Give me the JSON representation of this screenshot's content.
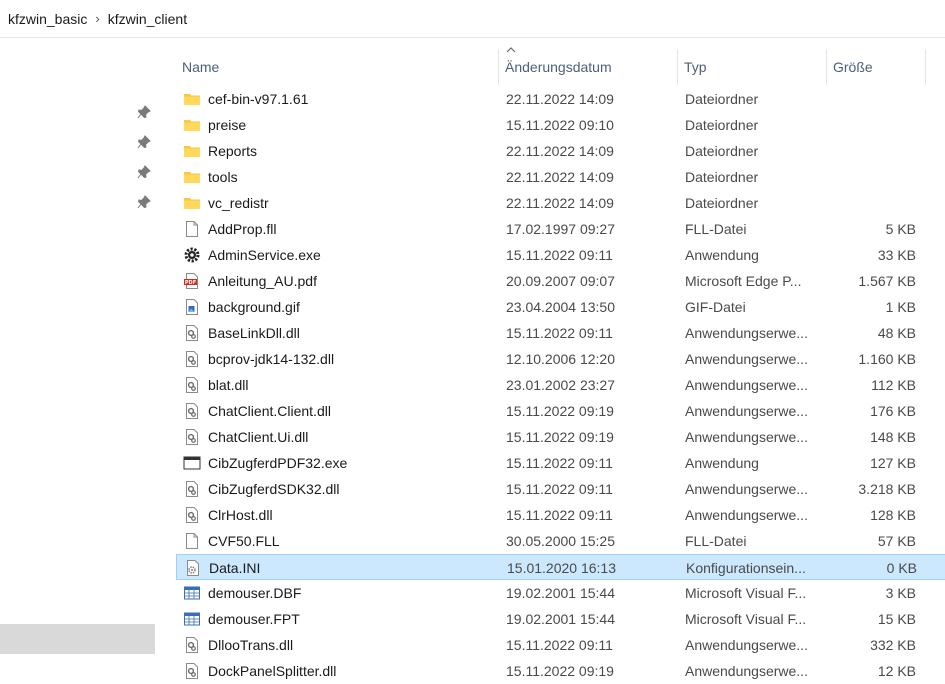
{
  "breadcrumb": [
    "kfzwin_basic",
    "kfzwin_client"
  ],
  "breadcrumb_separator": "›",
  "columns": {
    "name": "Name",
    "date": "Änderungsdatum",
    "type": "Typ",
    "size": "Größe"
  },
  "sort_indicator": "^",
  "files": [
    {
      "name": "cef-bin-v97.1.61",
      "date": "22.11.2022 14:09",
      "type": "Dateiordner",
      "size": "",
      "icon": "folder-icon"
    },
    {
      "name": "preise",
      "date": "15.11.2022 09:10",
      "type": "Dateiordner",
      "size": "",
      "icon": "folder-icon"
    },
    {
      "name": "Reports",
      "date": "22.11.2022 14:09",
      "type": "Dateiordner",
      "size": "",
      "icon": "folder-icon"
    },
    {
      "name": "tools",
      "date": "22.11.2022 14:09",
      "type": "Dateiordner",
      "size": "",
      "icon": "folder-icon"
    },
    {
      "name": "vc_redistr",
      "date": "22.11.2022 14:09",
      "type": "Dateiordner",
      "size": "",
      "icon": "folder-icon"
    },
    {
      "name": "AddProp.fll",
      "date": "17.02.1997 09:27",
      "type": "FLL-Datei",
      "size": "5 KB",
      "icon": "blank-file-icon"
    },
    {
      "name": "AdminService.exe",
      "date": "15.11.2022 09:11",
      "type": "Anwendung",
      "size": "33 KB",
      "icon": "gear-exe-icon"
    },
    {
      "name": "Anleitung_AU.pdf",
      "date": "20.09.2007 09:07",
      "type": "Microsoft Edge P...",
      "size": "1.567 KB",
      "icon": "pdf-icon"
    },
    {
      "name": "background.gif",
      "date": "23.04.2004 13:50",
      "type": "GIF-Datei",
      "size": "1 KB",
      "icon": "image-file-icon"
    },
    {
      "name": "BaseLinkDll.dll",
      "date": "15.11.2022 09:11",
      "type": "Anwendungserwe...",
      "size": "48 KB",
      "icon": "dll-icon"
    },
    {
      "name": "bcprov-jdk14-132.dll",
      "date": "12.10.2006 12:20",
      "type": "Anwendungserwe...",
      "size": "1.160 KB",
      "icon": "dll-icon"
    },
    {
      "name": "blat.dll",
      "date": "23.01.2002 23:27",
      "type": "Anwendungserwe...",
      "size": "112 KB",
      "icon": "dll-icon"
    },
    {
      "name": "ChatClient.Client.dll",
      "date": "15.11.2022 09:19",
      "type": "Anwendungserwe...",
      "size": "176 KB",
      "icon": "dll-icon"
    },
    {
      "name": "ChatClient.Ui.dll",
      "date": "15.11.2022 09:19",
      "type": "Anwendungserwe...",
      "size": "148 KB",
      "icon": "dll-icon"
    },
    {
      "name": "CibZugferdPDF32.exe",
      "date": "15.11.2022 09:11",
      "type": "Anwendung",
      "size": "127 KB",
      "icon": "window-exe-icon"
    },
    {
      "name": "CibZugferdSDK32.dll",
      "date": "15.11.2022 09:11",
      "type": "Anwendungserwe...",
      "size": "3.218 KB",
      "icon": "dll-icon"
    },
    {
      "name": "ClrHost.dll",
      "date": "15.11.2022 09:11",
      "type": "Anwendungserwe...",
      "size": "128 KB",
      "icon": "dll-icon"
    },
    {
      "name": "CVF50.FLL",
      "date": "30.05.2000 15:25",
      "type": "FLL-Datei",
      "size": "57 KB",
      "icon": "blank-file-icon"
    },
    {
      "name": "Data.INI",
      "date": "15.01.2020 16:13",
      "type": "Konfigurationsein...",
      "size": "0 KB",
      "icon": "ini-file-icon",
      "selected": true
    },
    {
      "name": "demouser.DBF",
      "date": "19.02.2001 15:44",
      "type": "Microsoft Visual F...",
      "size": "3 KB",
      "icon": "table-file-icon"
    },
    {
      "name": "demouser.FPT",
      "date": "19.02.2001 15:44",
      "type": "Microsoft Visual F...",
      "size": "15 KB",
      "icon": "table-file-icon"
    },
    {
      "name": "DllooTrans.dll",
      "date": "15.11.2022 09:11",
      "type": "Anwendungserwe...",
      "size": "332 KB",
      "icon": "dll-icon"
    },
    {
      "name": "DockPanelSplitter.dll",
      "date": "15.11.2022 09:19",
      "type": "Anwendungserwe...",
      "size": "12 KB",
      "icon": "dll-icon"
    }
  ],
  "nav_pins": [
    "pin-icon",
    "pin-icon",
    "pin-icon",
    "pin-icon"
  ],
  "colors": {
    "selected_bg": "#cce8ff",
    "selected_border": "#99d1ff",
    "folder": "#f8c93f",
    "header_text": "#4c607a"
  }
}
